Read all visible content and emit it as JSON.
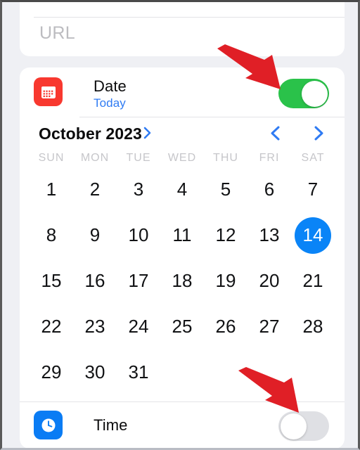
{
  "screen": {
    "background": "#eff0f4",
    "accent_blue": "#0a84f7",
    "accent_green": "#2ac24a",
    "annotation_color": "#e01f26"
  },
  "url_card": {
    "placeholder": "URL",
    "value": ""
  },
  "date_row": {
    "icon": "calendar-icon",
    "icon_color": "#f8382f",
    "title": "Date",
    "subtitle": "Today",
    "toggle": {
      "state": "on",
      "label": "Date toggle"
    }
  },
  "calendar": {
    "month_label": "October 2023",
    "month_chevron": "chevron-right-icon",
    "prev_label": "chevron-left-icon",
    "next_label": "chevron-right-icon",
    "weekdays": [
      "SUN",
      "MON",
      "TUE",
      "WED",
      "THU",
      "FRI",
      "SAT"
    ],
    "weeks": [
      [
        "",
        "1",
        "2",
        "3",
        "4",
        "5",
        "6",
        "7"
      ],
      [
        "8",
        "9",
        "10",
        "11",
        "12",
        "13",
        "14"
      ],
      [
        "15",
        "16",
        "17",
        "18",
        "19",
        "20",
        "21"
      ],
      [
        "22",
        "23",
        "24",
        "25",
        "26",
        "27",
        "28"
      ],
      [
        "29",
        "30",
        "31",
        "",
        "",
        "",
        ""
      ]
    ],
    "rows": {
      "w1": [
        "",
        "1",
        "2",
        "3",
        "4",
        "5",
        "6"
      ],
      "w2": [
        "7",
        "8",
        "9",
        "10",
        "11",
        "12",
        "13"
      ],
      "w3": [
        "14",
        "15",
        "16",
        "17",
        "18",
        "19",
        "20"
      ],
      "w4": [
        "21",
        "22",
        "23",
        "24",
        "25",
        "26",
        "27"
      ],
      "w5": [
        "28",
        "29",
        "30",
        "31",
        "",
        "",
        ""
      ]
    },
    "grid": [
      [
        "1",
        "2",
        "3",
        "4",
        "5",
        "6",
        "7"
      ],
      [
        "8",
        "9",
        "10",
        "11",
        "12",
        "13",
        "14"
      ],
      [
        "15",
        "16",
        "17",
        "18",
        "19",
        "20",
        "21"
      ],
      [
        "22",
        "23",
        "24",
        "25",
        "26",
        "27",
        "28"
      ],
      [
        "29",
        "30",
        "31",
        "",
        "",
        "",
        ""
      ]
    ],
    "selected_day": "14",
    "selected_row": 1,
    "selected_col": 6
  },
  "time_row": {
    "icon": "clock-icon",
    "icon_color": "#0a7cf4",
    "title": "Time",
    "toggle": {
      "state": "off",
      "label": "Time toggle"
    }
  },
  "annotations": [
    {
      "name": "arrow-to-date-toggle",
      "direction": "down-right"
    },
    {
      "name": "arrow-to-time-toggle",
      "direction": "down-right"
    }
  ]
}
